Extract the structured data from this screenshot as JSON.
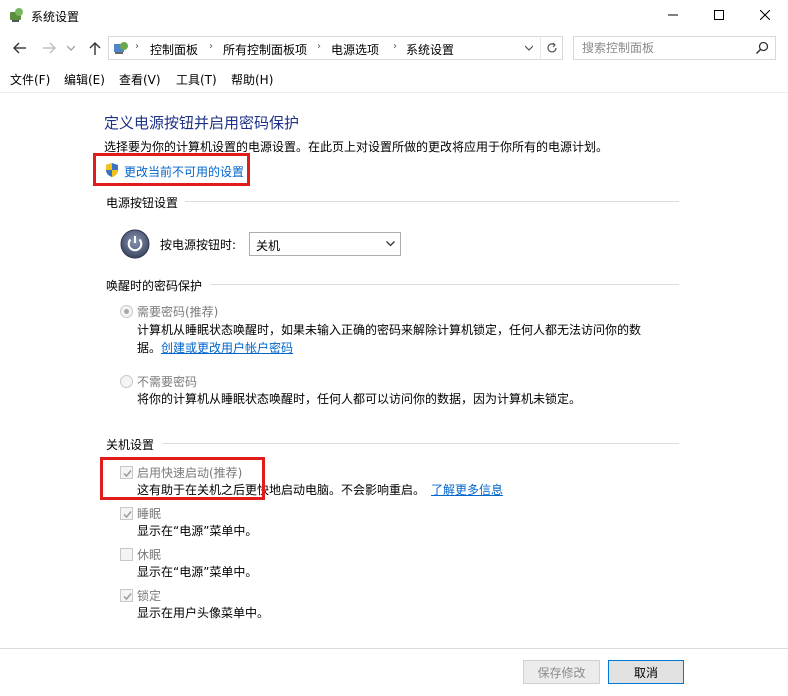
{
  "window": {
    "title": "系统设置"
  },
  "address": {
    "breadcrumbs": [
      "控制面板",
      "所有控制面板项",
      "电源选项",
      "系统设置"
    ]
  },
  "search": {
    "placeholder": "搜索控制面板"
  },
  "menu": {
    "items": [
      "文件(F)",
      "编辑(E)",
      "查看(V)",
      "工具(T)",
      "帮助(H)"
    ]
  },
  "page": {
    "title": "定义电源按钮并启用密码保护",
    "description": "选择要为你的计算机设置的电源设置。在此页上对设置所做的更改将应用于你所有的电源计划。",
    "change_link": "更改当前不可用的设置"
  },
  "power_button": {
    "section_title": "电源按钮设置",
    "label": "按电源按钮时:",
    "selected_value": "关机"
  },
  "wake_password": {
    "section_title": "唤醒时的密码保护",
    "require": {
      "label": "需要密码(推荐)",
      "selected": true,
      "desc_line1": "计算机从睡眠状态唤醒时，如果未输入正确的密码来解除计算机锁定，任何人都无法访问你的数",
      "desc_line2_prefix": "据。",
      "desc_link": "创建或更改用户帐户密码"
    },
    "no_require": {
      "label": "不需要密码",
      "selected": false,
      "desc": "将你的计算机从睡眠状态唤醒时，任何人都可以访问你的数据，因为计算机未锁定。"
    }
  },
  "shutdown": {
    "section_title": "关机设置",
    "options": [
      {
        "label": "启用快速启动(推荐)",
        "checked": true,
        "desc": "这有助于在关机之后更快地启动电脑。不会影响重启。",
        "link": "了解更多信息"
      },
      {
        "label": "睡眠",
        "checked": true,
        "desc": "显示在“电源”菜单中。"
      },
      {
        "label": "休眠",
        "checked": false,
        "desc": "显示在“电源”菜单中。"
      },
      {
        "label": "锁定",
        "checked": true,
        "desc": "显示在用户头像菜单中。"
      }
    ]
  },
  "buttons": {
    "save": "保存修改",
    "cancel": "取消"
  },
  "colors": {
    "title_blue": "#1e3287",
    "link_blue": "#0066cc",
    "highlight_red": "#e01c1c"
  }
}
